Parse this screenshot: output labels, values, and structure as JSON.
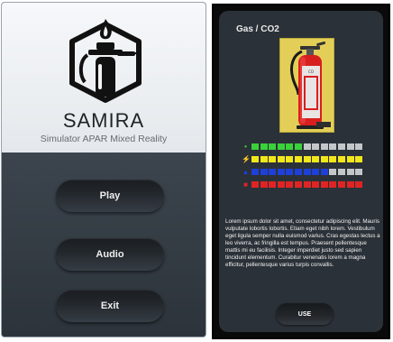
{
  "menu": {
    "app_name": "SAMIRA",
    "subtitle": "Simulator APAR Mixed Reality",
    "buttons": {
      "play": "Play",
      "audio": "Audio",
      "exit": "Exit"
    }
  },
  "item": {
    "title": "Gas / CO2",
    "image_label": "extinguisher-image",
    "label_text": "CO",
    "stats": [
      {
        "name": "effectiveness",
        "icon": "leaf-icon",
        "filled": 6,
        "total": 13,
        "color": "#3ad13a"
      },
      {
        "name": "electric",
        "icon": "lightning-icon",
        "filled": 13,
        "total": 13,
        "color": "#f2e71a"
      },
      {
        "name": "liquid",
        "icon": "liquid-icon",
        "filled": 9,
        "total": 13,
        "color": "#1e3fd8"
      },
      {
        "name": "flammable",
        "icon": "flame-icon",
        "filled": 13,
        "total": 13,
        "color": "#e02424"
      }
    ],
    "description": "Lorem ipsum dolor sit amet, consectetur adipiscing elit. Mauris vulputate lobortis lobortis. Etiam eget nibh lorem. Vestibulum eget ligula semper nulla euismod varius. Cras egestas lectus a leo viverra, ac fringilla est tempus. Praesent pellentesque mattis mi eu facilisis. Integer imperdiet justo sed sapien tincidunt elementum. Curabitur venenatis lorem a magna efficitur, pellentesque varius turpis convallis.",
    "use_button": "USE"
  }
}
